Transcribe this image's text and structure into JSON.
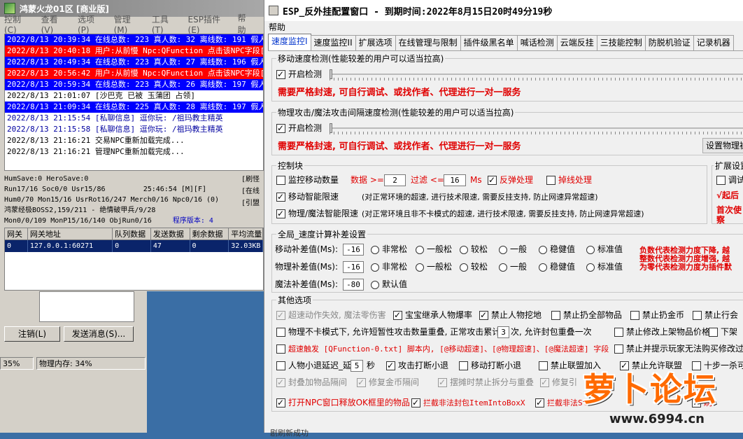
{
  "left_window": {
    "title": "鸿蒙火龙01区 [商业版]",
    "menu": [
      "控制(C)",
      "查看(V)",
      "选项(P)",
      "管理(M)",
      "工具(T)",
      "ESP插件(E)",
      "帮助"
    ],
    "log_lines": [
      {
        "text": "2022/8/13 20:39:34 在线总数: 223 真人数: 32 离线数: 191 假人数",
        "style": "blue"
      },
      {
        "text": "2022/8/13 20:40:18 用户:从前慢 Npc:QFunction 点击该NPC字段[@",
        "style": "red"
      },
      {
        "text": "2022/8/13 20:49:34 在线总数: 223 真人数: 27 离线数: 196 假人数",
        "style": "blue"
      },
      {
        "text": "2022/8/13 20:56:42 用户:从前慢 Npc:QFunction 点击该NPC字段[@",
        "style": "red"
      },
      {
        "text": "2022/8/13 20:59:34 在线总数: 223 真人数: 26 离线数: 197 假人数",
        "style": "blue"
      },
      {
        "text": "2022/8/13 21:01:07 [沙巴克 已被 玉蒲团 占领]",
        "style": "plain"
      },
      {
        "text": "2022/8/13 21:09:34 在线总数: 225 真人数: 28 离线数: 197 假人数",
        "style": "blue"
      },
      {
        "text": "2022/8/13 21:15:54 [私聊信息] 逗你玩: /祖玛教主精英",
        "style": "plain"
      },
      {
        "text": "2022/8/13 21:15:58 [私聊信息] 逗你玩: /祖玛教主精英",
        "style": "plain"
      },
      {
        "text": "2022/8/13 21:16:21 交易NPC重新加载完成...",
        "style": "plain"
      },
      {
        "text": "2022/8/13 21:16:21 管理NPC重新加载完成...",
        "style": "plain"
      }
    ],
    "stats": {
      "line1": "HumSave:0 HeroSave:0",
      "line2": "Run17/16 Soc0/0 Usr15/86",
      "time": "25:46:54 [M][F]",
      "line3": "Hum0/70 Mon15/16 UsrRot16/247 Merch0/16 Npc0/16 (0)",
      "line4": "鸿蒙经极BOSS2,159/211 - 绝情破甲兵/9/28",
      "line5": "Mon0/0/109 MonP15/16/140 ObjRun0/16",
      "version": "程序版本: 4",
      "side_labels": [
        "[刷怪",
        "[在线",
        "[引盟"
      ]
    },
    "connection_table": {
      "headers": [
        "网关",
        "网关地址",
        "队列数据",
        "发送数据",
        "剩余数据",
        "平均流量"
      ],
      "rows": [
        [
          "0",
          "127.0.0.1:60271",
          "0",
          "47",
          "0",
          "32.03KB"
        ]
      ]
    },
    "buttons": {
      "logout": "注销(L)",
      "send": "发送消息(S)..."
    },
    "statusbar": {
      "cpu": "35%",
      "memory": "物理内存: 34%"
    }
  },
  "right_window": {
    "title": "ESP_反外挂配置窗口 - 到期时间:2022年8月15日20时49分19秒",
    "menu_help": "帮助",
    "tabs": [
      "速度监控I",
      "速度监控II",
      "扩展选项",
      "在线管理与限制",
      "插件级黑名单",
      "喊话检测",
      "云端反挂",
      "三技能控制",
      "防脱机验证",
      "记录机器"
    ],
    "active_tab": "速度监控I",
    "move_group": {
      "title": "移动速度检测(性能较差的用户可以适当拉高)",
      "enable_label": "开启检测",
      "enabled": true,
      "note": "需要严格封速, 可自行调试、或找作者、代理进行一对一服务"
    },
    "attack_group": {
      "title": "物理攻击/魔法攻击间隔速度检测(性能较差的用户可以适当拉高)",
      "enable_label": "开启检测",
      "enabled": true,
      "note": "需要严格封速, 可自行调试、或找作者、代理进行一对一服务",
      "physics_button": "设置物理被"
    },
    "control_group": {
      "title": "控制块",
      "monitor_label": "监控移动数量",
      "monitor_checked": false,
      "data_label": "数据 >=",
      "data_value": "2",
      "filter_label": "过滤 <=",
      "filter_value": "16",
      "ms_label": "Ms",
      "bounce_label": "反弹处理",
      "bounce_checked": true,
      "drop_label": "掉线处理",
      "drop_checked": false,
      "smart_move_label": "移动智能限速",
      "smart_move_checked": true,
      "smart_move_desc": "(对正常环境的超速, 进行技术限速, 需要反挂支持, 防止网速异常超速)",
      "smart_phys_label": "物理/魔法智能限速",
      "smart_phys_checked": true,
      "smart_phys_desc": "(对正常环境且非不卡模式的超速, 进行技术限速, 需要反挂支持, 防止网速异常超速)"
    },
    "ext_group": {
      "title": "扩展设置",
      "debug_label": "调试",
      "start_label": "√起后",
      "first_label": "首次使",
      "first_label2": "察"
    },
    "comp_group": {
      "title": "全局_速度计算补差设置",
      "move_label": "移动补差值(Ms):",
      "move_value": "-16",
      "phys_label": "物理补差值(Ms):",
      "phys_value": "-16",
      "magic_label": "魔法补差值(Ms):",
      "magic_value": "-80",
      "options": [
        "非常松",
        "一般松",
        "较松",
        "一般",
        "稳健值",
        "标准值"
      ],
      "magic_option": "默认值",
      "warn1": "负数代表检测力度下降, 越",
      "warn2": "整数代表检测力度增强, 越",
      "warn3": "为零代表检测力度为插件默"
    },
    "other_group": {
      "title": "其他选项",
      "row1": [
        {
          "label": "超速动作失效, 魔法零伤害",
          "checked": true,
          "disabled": true
        },
        {
          "label": "宝宝继承人物爆率",
          "checked": true,
          "disabled": false
        },
        {
          "label": "禁止人物挖地",
          "checked": true,
          "disabled": false
        },
        {
          "label": "禁止扔全部物品",
          "checked": false,
          "disabled": false
        },
        {
          "label": "禁止扔金币",
          "checked": false,
          "disabled": false
        },
        {
          "label": "禁止行会",
          "checked": false,
          "disabled": false
        }
      ],
      "row2_a": "物理不卡模式下, 允许短暂性攻击数量重叠, 正常攻击累计",
      "row2_val": "3",
      "row2_b": "次, 允许封包重叠一次",
      "row2_c": "禁止修改上架物品价格",
      "row2_d": "下架",
      "row3_a": "超速触发 [QFunction-0.txt] 脚本内, [@移动超速]、[@物理超速]、[@魔法超速] 字段",
      "row3_b": "禁止并提示玩家无法购买修改过",
      "row4": [
        {
          "label": "人物小退延迟_延",
          "checked": false
        },
        {
          "label": "攻击打断小退",
          "checked": true
        },
        {
          "label": "移动打断小退",
          "checked": false
        },
        {
          "label": "禁止联盟加入",
          "checked": false
        },
        {
          "label": "禁止允许联盟",
          "checked": true
        },
        {
          "label": "十步一杀可",
          "checked": false
        }
      ],
      "row4_val": "5",
      "row4_unit": "秒",
      "row5": [
        {
          "label": "封叠加物品隔间",
          "checked": true
        },
        {
          "label": "修复金币隔间",
          "checked": true
        },
        {
          "label": "摆摊时禁止拆分与重叠",
          "checked": true
        },
        {
          "label": "修复引",
          "checked": true
        }
      ],
      "row6": [
        {
          "label": "打开NPC窗口释放OK框里的物品",
          "checked": true
        },
        {
          "label": "拦截非法封包ItemIntoBoxX",
          "checked": true
        },
        {
          "label": "拦截非法St",
          "checked": true
        },
        {
          "label": "刷",
          "checked": true
        }
      ]
    },
    "bottom_text": "剧刷新成功"
  },
  "watermark": {
    "title": "萝卜论坛",
    "url": "www.6994.cn"
  }
}
